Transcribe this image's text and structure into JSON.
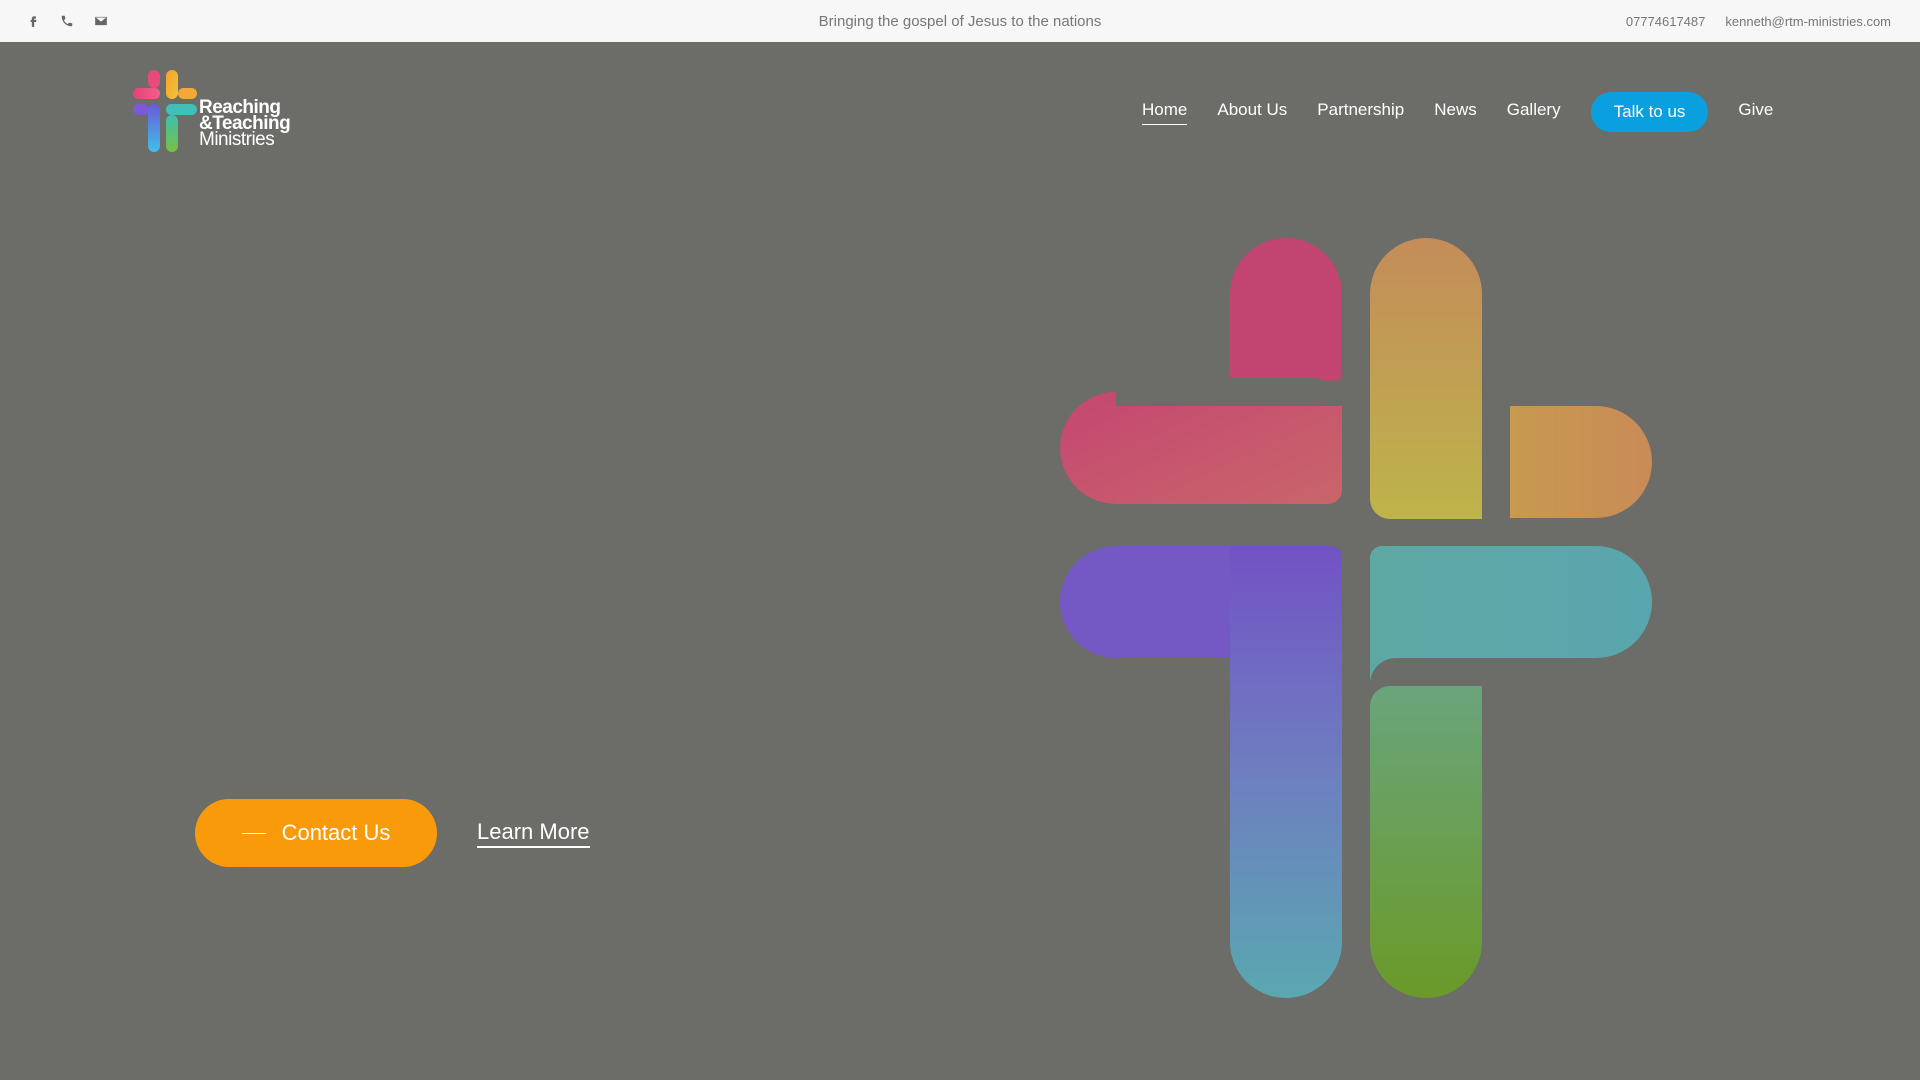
{
  "topbar": {
    "social_icons": [
      "facebook-icon",
      "phone-icon",
      "email-icon"
    ],
    "tagline": "Bringing the gospel of Jesus to the nations",
    "phone": "07774617487",
    "email": "kenneth@rtm-ministries.com"
  },
  "header": {
    "logo": {
      "line1": "Reaching",
      "line2": "&Teaching",
      "line3": "Ministries"
    },
    "nav": {
      "home": "Home",
      "about": "About Us",
      "partnership": "Partnership",
      "news": "News",
      "gallery": "Gallery",
      "talk": "Talk to us",
      "give": "Give"
    }
  },
  "hero": {
    "contact_label": "Contact Us",
    "learn_label": "Learn More"
  },
  "colors": {
    "background": "#6c6c68",
    "topbar": "#f7f7f7",
    "accent_blue": "#0aa0e0",
    "accent_orange": "#f99a0a"
  }
}
